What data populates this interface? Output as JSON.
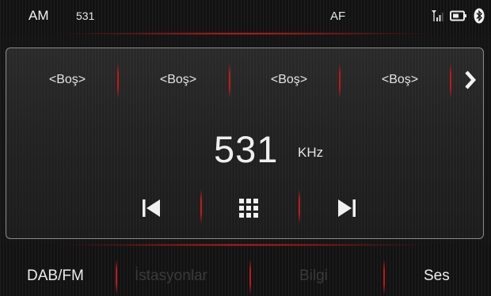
{
  "status": {
    "band": "AM",
    "frequency": "531",
    "af": "AF",
    "icons": [
      "signal-icon",
      "battery-icon",
      "bluetooth-icon"
    ]
  },
  "presets": [
    "<Boş>",
    "<Boş>",
    "<Boş>",
    "<Boş>"
  ],
  "tuner": {
    "frequency": "531",
    "unit": "KHz"
  },
  "controls": [
    "previous-icon",
    "grid-menu-icon",
    "next-track-icon"
  ],
  "bottom_tabs": [
    {
      "label": "DAB/FM",
      "state": "active"
    },
    {
      "label": "İstasyonlar",
      "state": "disabled"
    },
    {
      "label": "Bilgi",
      "state": "disabled"
    },
    {
      "label": "Ses",
      "state": "active"
    }
  ],
  "colors": {
    "accent": "#c01a1a",
    "text": "#e8e8e8",
    "disabled_text": "#3a3a3a"
  }
}
